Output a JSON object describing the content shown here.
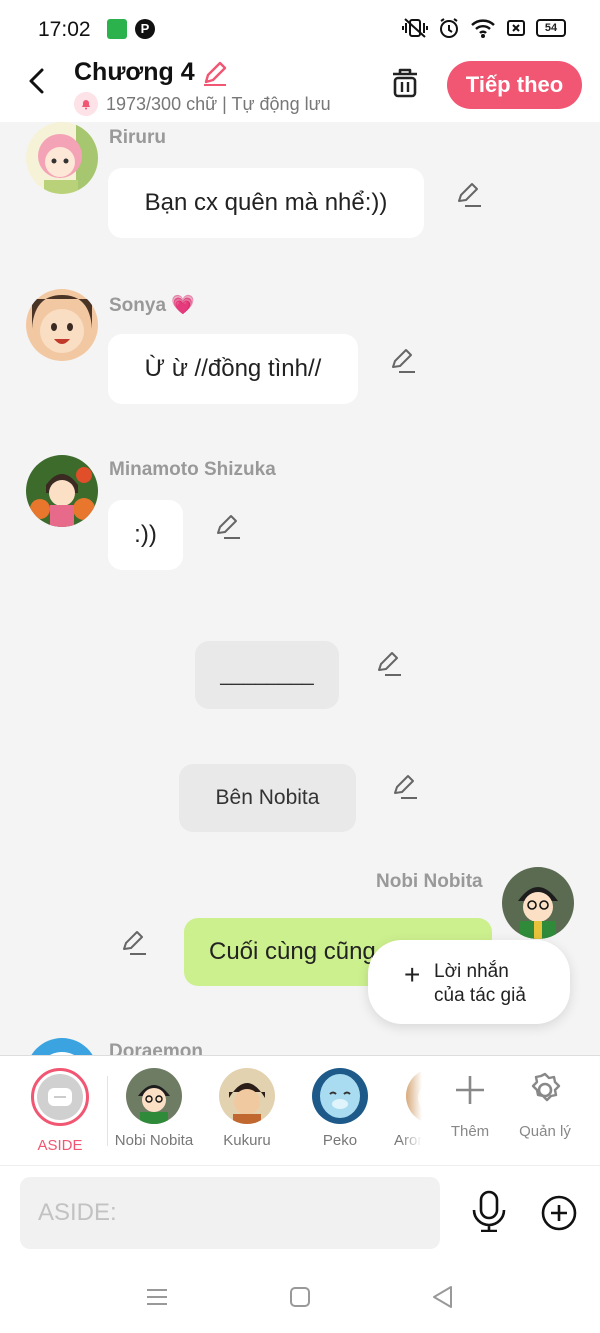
{
  "status_bar": {
    "time": "17:02",
    "battery": "54",
    "pinterest_glyph": "P"
  },
  "header": {
    "title": "Chương 4",
    "subtitle": "1973/300 chữ | Tự động lưu",
    "next_label": "Tiếp theo"
  },
  "messages": [
    {
      "name": "Riruru",
      "text": "Bạn cx quên mà nhể:))"
    },
    {
      "name": "Sonya",
      "emoji": "💗",
      "text": "Ừ ừ //đồng tình//"
    },
    {
      "name": "Minamoto Shizuka",
      "text": ":))"
    },
    {
      "text": "________"
    },
    {
      "text": "Bên Nobita"
    },
    {
      "name": "Nobi Nobita",
      "text": "Cuối cùng cũng"
    },
    {
      "name": "Doraemon"
    }
  ],
  "author_note": {
    "label": "Lời nhắn\ncủa tác giả"
  },
  "characters": [
    {
      "name": "ASIDE",
      "active": true
    },
    {
      "name": "Nobi Nobita"
    },
    {
      "name": "Kukuru"
    },
    {
      "name": "Peko"
    },
    {
      "name": "Aron"
    }
  ],
  "tools": {
    "add": "Thêm",
    "manage": "Quản lý"
  },
  "composer": {
    "placeholder": "ASIDE:"
  },
  "colors": {
    "accent": "#f15672",
    "green_bubble": "#cdf08e"
  }
}
